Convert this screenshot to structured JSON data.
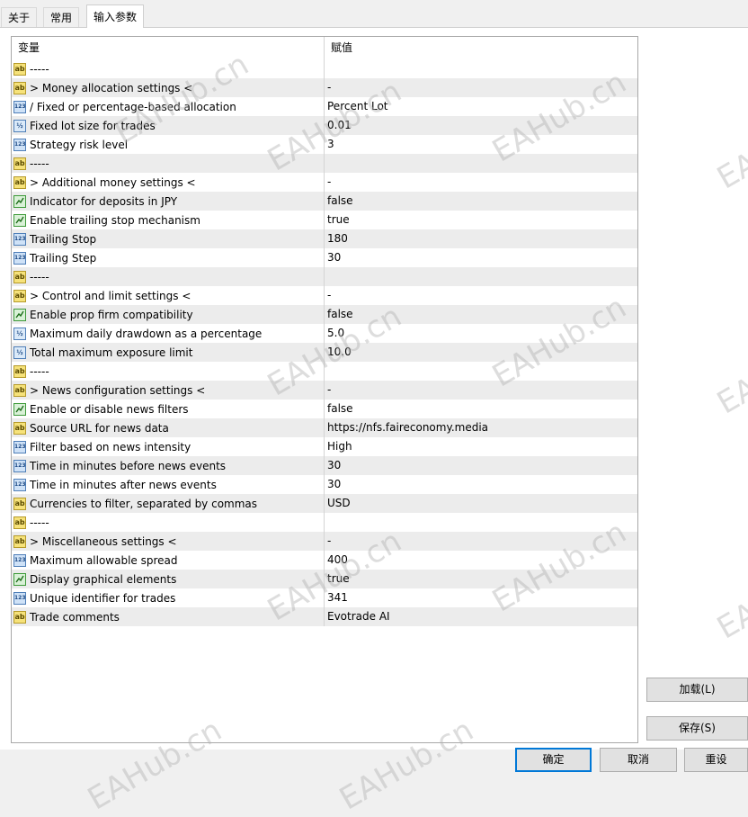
{
  "tabs": [
    {
      "label": "关于"
    },
    {
      "label": "常用"
    },
    {
      "label": "输入参数"
    }
  ],
  "grid": {
    "headers": {
      "name": "变量",
      "value": "赋值"
    },
    "rows": [
      {
        "icon": "ab",
        "name": "-----",
        "value": ""
      },
      {
        "icon": "ab",
        "name": "> Money allocation settings <",
        "value": "-"
      },
      {
        "icon": "123",
        "name": "/ Fixed or percentage-based allocation",
        "value": "Percent Lot"
      },
      {
        "icon": "half",
        "name": "Fixed lot size for trades",
        "value": "0.01"
      },
      {
        "icon": "123",
        "name": "Strategy risk level",
        "value": "3"
      },
      {
        "icon": "ab",
        "name": "-----",
        "value": ""
      },
      {
        "icon": "ab",
        "name": "> Additional money settings <",
        "value": "-"
      },
      {
        "icon": "tf",
        "name": "Indicator for deposits in JPY",
        "value": "false"
      },
      {
        "icon": "tf",
        "name": "Enable trailing stop mechanism",
        "value": "true"
      },
      {
        "icon": "123",
        "name": "Trailing Stop",
        "value": "180"
      },
      {
        "icon": "123",
        "name": "Trailing Step",
        "value": "30"
      },
      {
        "icon": "ab",
        "name": "-----",
        "value": ""
      },
      {
        "icon": "ab",
        "name": "> Control and limit settings <",
        "value": "-"
      },
      {
        "icon": "tf",
        "name": "Enable prop firm compatibility",
        "value": "false"
      },
      {
        "icon": "half",
        "name": "Maximum daily drawdown as a percentage",
        "value": "5.0"
      },
      {
        "icon": "half",
        "name": "Total maximum exposure limit",
        "value": "10.0"
      },
      {
        "icon": "ab",
        "name": "-----",
        "value": ""
      },
      {
        "icon": "ab",
        "name": "> News configuration settings <",
        "value": "-"
      },
      {
        "icon": "tf",
        "name": "Enable or disable news filters",
        "value": "false"
      },
      {
        "icon": "ab",
        "name": "Source URL for news data",
        "value": "https://nfs.faireconomy.media"
      },
      {
        "icon": "123",
        "name": "Filter based on news intensity",
        "value": "High"
      },
      {
        "icon": "123",
        "name": "Time in minutes before news events",
        "value": "30"
      },
      {
        "icon": "123",
        "name": "Time in minutes after news events",
        "value": "30"
      },
      {
        "icon": "ab",
        "name": "Currencies to filter, separated by commas",
        "value": "USD"
      },
      {
        "icon": "ab",
        "name": "-----",
        "value": ""
      },
      {
        "icon": "ab",
        "name": "> Miscellaneous settings <",
        "value": "-"
      },
      {
        "icon": "123",
        "name": "Maximum allowable spread",
        "value": "400"
      },
      {
        "icon": "tf",
        "name": "Display graphical elements",
        "value": "true"
      },
      {
        "icon": "123",
        "name": "Unique identifier for trades",
        "value": "341"
      },
      {
        "icon": "ab",
        "name": "Trade comments",
        "value": "Evotrade AI"
      }
    ]
  },
  "buttons": {
    "load": "加载(L)",
    "save": "保存(S)",
    "ok": "确定",
    "cancel": "取消",
    "reset": "重设"
  },
  "icon_glyphs": {
    "ab": "ab",
    "123": "123",
    "half": "½"
  },
  "watermark": "EAHub.cn"
}
